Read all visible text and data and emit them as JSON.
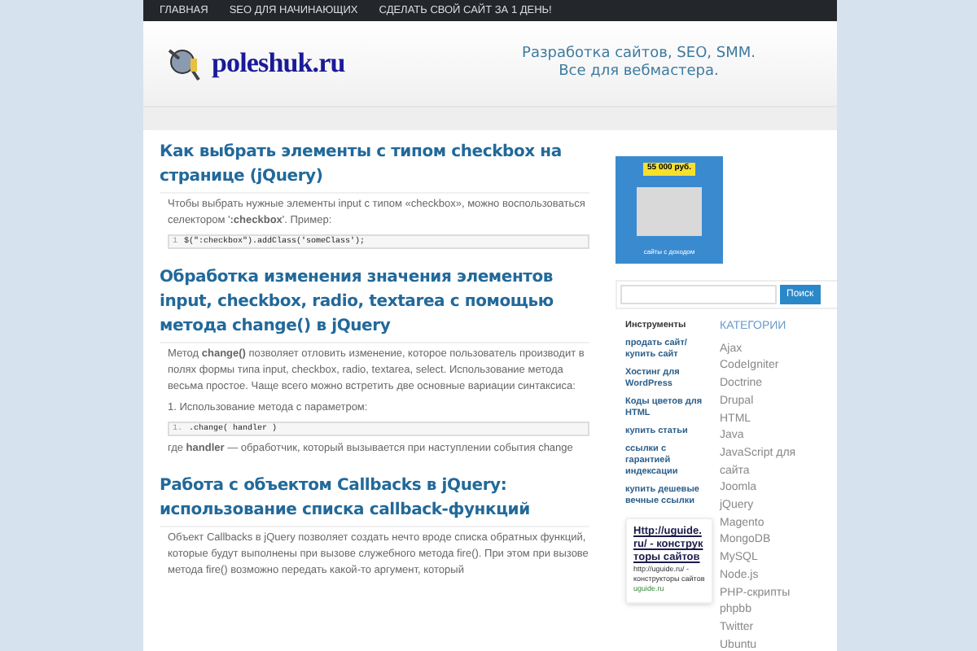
{
  "top_nav": [
    {
      "label": "ГЛАВНАЯ"
    },
    {
      "label": "SEO ДЛЯ НАЧИНАЮЩИХ"
    },
    {
      "label": "СДЕЛАТЬ СВОЙ САЙТ ЗА 1 ДЕНЬ!"
    }
  ],
  "header": {
    "logo": "poleshuk.ru",
    "tagline": [
      "Разработка сайтов, SEO, SMM.",
      "Все для вебмастера."
    ]
  },
  "posts": [
    {
      "title": "Как выбрать элементы с типом checkbox на странице (jQuery)",
      "blocks": [
        {
          "kind": "text",
          "text": "Чтобы выбрать нужные элементы input с типом «checkbox», можно воспользоваться селектором '**:checkbox**'. Пример:"
        },
        {
          "kind": "code",
          "line": "1",
          "code": "$(\":checkbox\").addClass('someClass');"
        }
      ]
    },
    {
      "title": "Обработка изменения значения элементов input, checkbox, radio, textarea с помощью метода change() в jQuery",
      "blocks": [
        {
          "kind": "text",
          "text": "Метод **change()** позволяет отловить изменение, которое пользователь производит в полях формы типа input, checkbox, radio, textarea, select. Использование метода весьма простое. Чаще всего можно встретить две основные вариации синтаксиса:"
        },
        {
          "kind": "text",
          "text": "1. Использование метода с параметром:"
        },
        {
          "kind": "code",
          "line": "1.",
          "code": ".change( handler )"
        },
        {
          "kind": "text",
          "text": "где **handler** — обработчик, который вызывается при наступлении события change"
        }
      ]
    },
    {
      "title": "Работа с объектом Callbacks в jQuery: использование списка callback-функций",
      "blocks": [
        {
          "kind": "text",
          "text": "Объект Callbacks в jQuery позволяет создать нечто вроде списка обратных функций, которые будут выполнены при вызове служебного метода fire(). При этом при вызове метода fire() возможно передать какой-то аргумент, который"
        }
      ]
    }
  ],
  "sidebar": {
    "banner": {
      "price": "55 000 руб.",
      "caption": "сайты с доходом"
    },
    "search": {
      "button": "Поиск"
    },
    "tools": {
      "title": "Инструменты",
      "links": [
        "продать сайт/купить сайт",
        "Хостинг для WordPress",
        "Коды цветов для HTML",
        "купить статьи",
        "ссылки с гарантией индексации",
        "купить дешевые вечные ссылки"
      ]
    },
    "ad": {
      "title": "Http://uguide.ru/ - конструкторы сайтов",
      "text": "http://uguide.ru/ - конструкторы сайтов",
      "url": "uguide.ru"
    },
    "categories": {
      "title": "КАТЕГОРИИ",
      "items": [
        "Ajax",
        "CodeIgniter",
        "Doctrine",
        "Drupal",
        "HTML",
        "Java",
        "JavaScript для сайта",
        "Joomla",
        "jQuery",
        "Magento",
        "MongoDB",
        "MySQL",
        "Node.js",
        "PHP-скрипты",
        "phpbb",
        "Twitter",
        "Ubuntu"
      ]
    }
  }
}
